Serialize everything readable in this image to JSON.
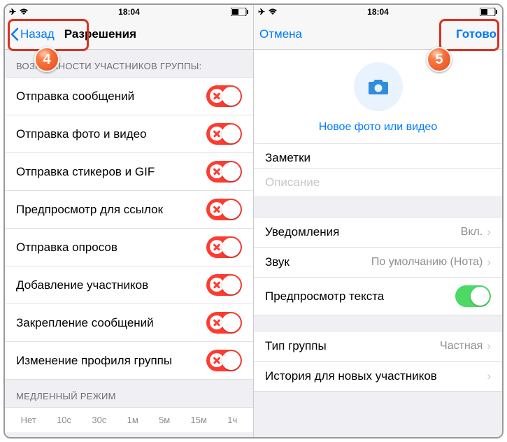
{
  "left": {
    "status": {
      "time": "18:04"
    },
    "nav": {
      "back": "Назад",
      "title": "Разрешения"
    },
    "section1": "ВОЗМОЖНОСТИ УЧАСТНИКОВ ГРУППЫ:",
    "perms": [
      "Отправка сообщений",
      "Отправка фото и видео",
      "Отправка стикеров и GIF",
      "Предпросмотр для ссылок",
      "Отправка опросов",
      "Добавление участников",
      "Закрепление сообщений",
      "Изменение профиля группы"
    ],
    "section2": "МЕДЛЕННЫЙ РЕЖИМ",
    "slow": [
      "Нет",
      "10с",
      "30с",
      "1м",
      "5м",
      "15м",
      "1ч"
    ],
    "badge": "4"
  },
  "right": {
    "status": {
      "time": "18:04"
    },
    "nav": {
      "cancel": "Отмена",
      "done": "Готово"
    },
    "photolink": "Новое фото или видео",
    "notes": {
      "title": "Заметки",
      "desc": "Описание"
    },
    "rows": {
      "notifications": {
        "label": "Уведомления",
        "value": "Вкл."
      },
      "sound": {
        "label": "Звук",
        "value": "По умолчанию (Нота)"
      },
      "preview": {
        "label": "Предпросмотр текста"
      },
      "grouptype": {
        "label": "Тип группы",
        "value": "Частная"
      },
      "history": {
        "label": "История для новых участников"
      }
    },
    "badge": "5"
  }
}
